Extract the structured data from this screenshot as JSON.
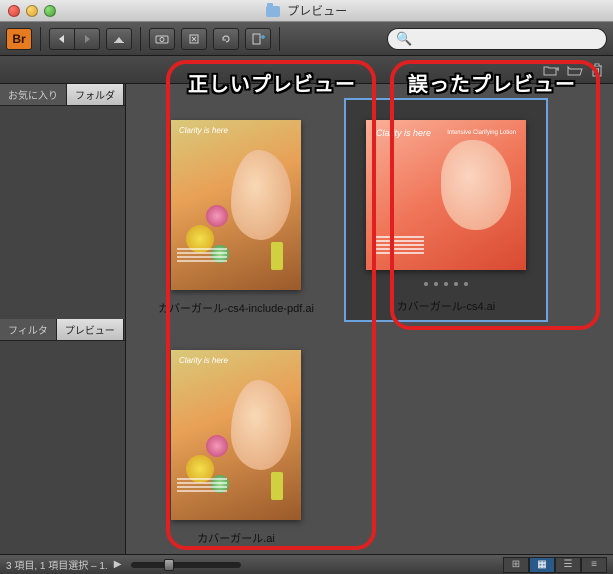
{
  "window": {
    "title": "プレビュー"
  },
  "toolbar": {
    "app_logo": "Br",
    "back": "◀",
    "fwd": "▶",
    "search_placeholder": ""
  },
  "sidebar": {
    "tabs1": [
      {
        "label": "お気に入り",
        "active": false
      },
      {
        "label": "フォルダ",
        "active": true
      }
    ],
    "tabs2": [
      {
        "label": "フィルタ",
        "active": false
      },
      {
        "label": "プレビュー",
        "active": true
      }
    ]
  },
  "content": {
    "items": [
      {
        "filename": "カバーガール-cs4-include-pdf.ai",
        "artwork": "a",
        "headline": "Clarity is here",
        "selected": false
      },
      {
        "filename": "カバーガール-cs4.ai",
        "artwork": "b",
        "headline": "Clarity is here",
        "subhead": "Intensive Clarifying Lotion",
        "selected": true,
        "rating_dots": 5
      },
      {
        "filename": "カバーガール.ai",
        "artwork": "a",
        "headline": "Clarity is here",
        "selected": false
      }
    ]
  },
  "annotations": {
    "correct": "正しいプレビュー",
    "wrong": "誤ったプレビュー"
  },
  "statusbar": {
    "text": "3 項目, 1 項目選択 – 1."
  }
}
